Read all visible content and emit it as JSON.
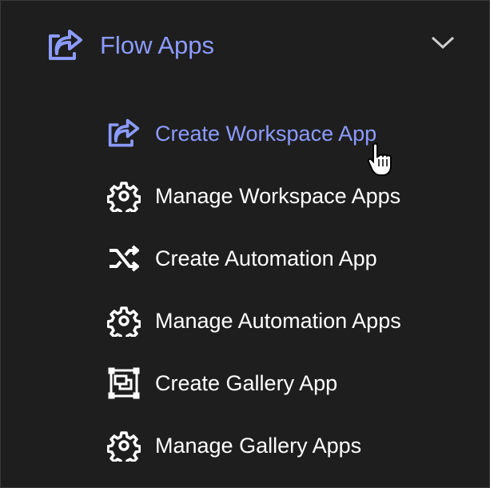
{
  "colors": {
    "accent": "#8c9bff",
    "background": "#1e1e1e",
    "text": "#ffffff"
  },
  "menu": {
    "title": "Flow Apps",
    "title_icon": "share-icon",
    "expanded": true,
    "items": [
      {
        "label": "Create Workspace App",
        "icon": "share-icon",
        "active": true
      },
      {
        "label": "Manage Workspace Apps",
        "icon": "gear-icon"
      },
      {
        "label": "Create Automation App",
        "icon": "shuffle-icon"
      },
      {
        "label": "Manage Automation Apps",
        "icon": "gear-icon"
      },
      {
        "label": "Create Gallery App",
        "icon": "gallery-icon"
      },
      {
        "label": "Manage Gallery Apps",
        "icon": "gear-icon"
      }
    ]
  }
}
